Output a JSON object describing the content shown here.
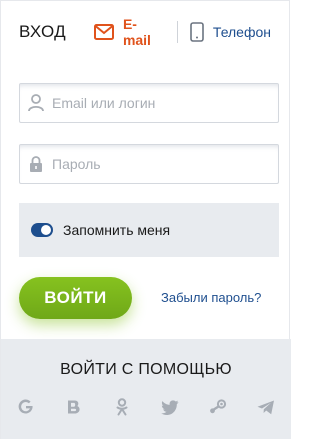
{
  "header": {
    "title": "ВХОД",
    "email_tab": "E-mail",
    "phone_tab": "Телефон"
  },
  "form": {
    "login_placeholder": "Email или логин",
    "password_placeholder": "Пароль",
    "remember_label": "Запомнить меня",
    "remember_checked": true,
    "login_button": "ВОЙТИ",
    "forgot_link": "Забыли пароль?"
  },
  "social": {
    "title": "ВОЙТИ С ПОМОЩЬЮ",
    "icons": [
      "google-icon",
      "vk-icon",
      "odnoklassniki-icon",
      "twitter-icon",
      "steam-icon",
      "telegram-icon"
    ]
  },
  "colors": {
    "accent_orange": "#e0531c",
    "link_blue": "#1f4f8f",
    "button_green": "#7ab51d",
    "panel_grey": "#e8ebef"
  }
}
